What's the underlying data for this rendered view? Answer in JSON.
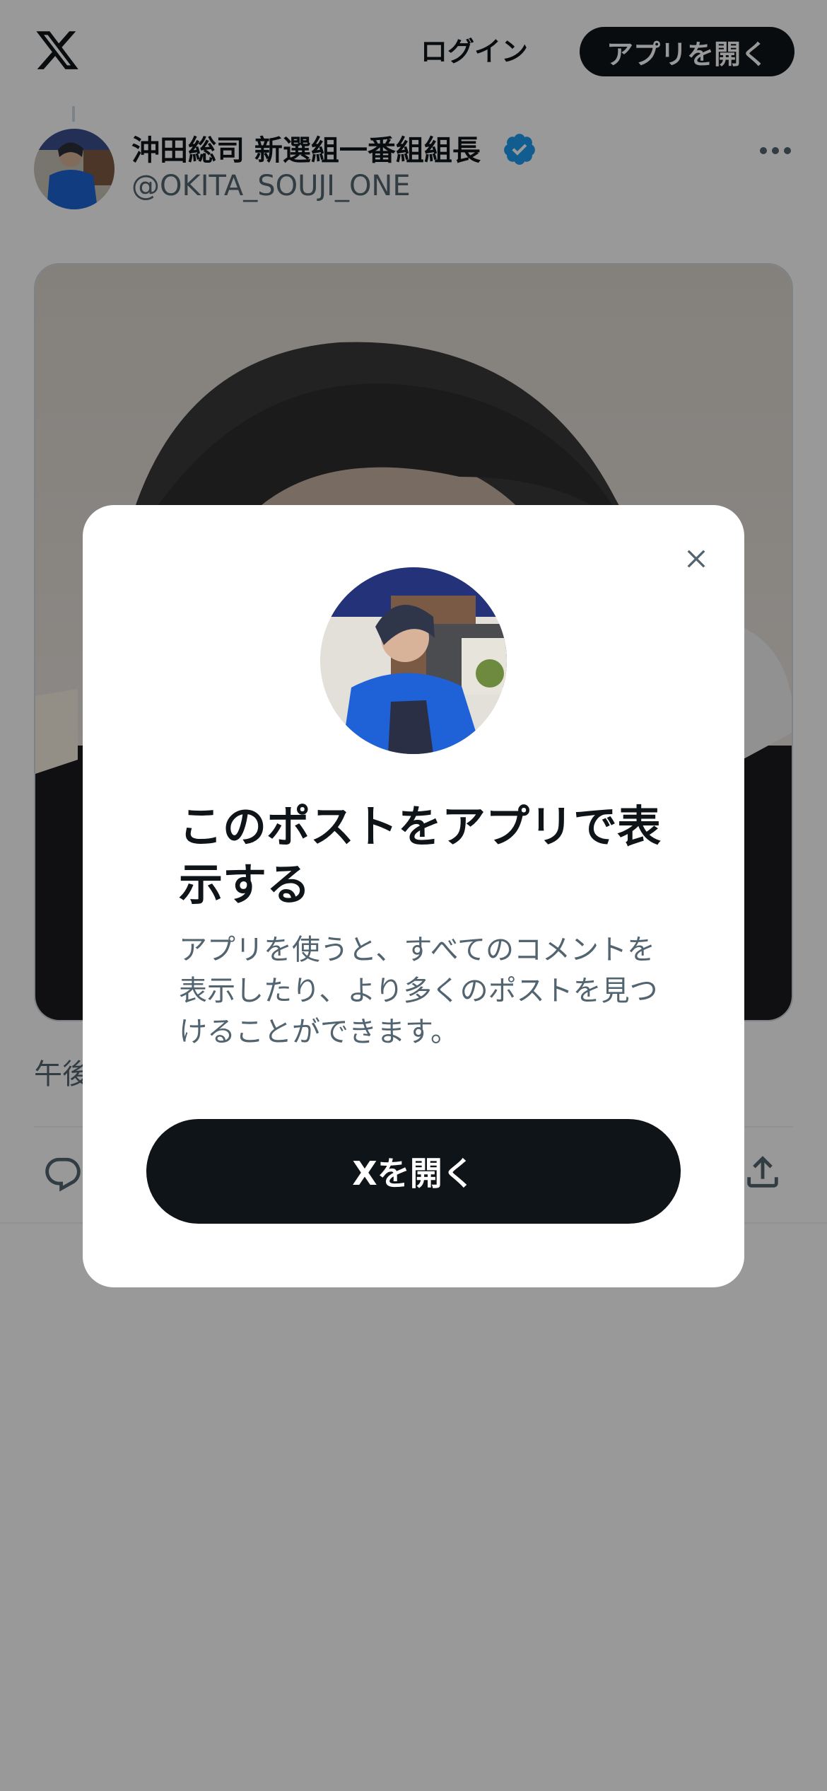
{
  "header": {
    "logo_icon": "x-logo-icon",
    "login_label": "ログイン",
    "open_app_label": "アプリを開く"
  },
  "post": {
    "display_name": "沖田総司 新選組一番組組長",
    "handle": "@OKITA_SOUJI_ONE",
    "verified": true,
    "timestamp_partial": "午後",
    "icons": [
      "more-icon",
      "reply-icon",
      "share-icon"
    ]
  },
  "modal": {
    "title": "このポストをアプリで表示する",
    "description": "アプリを使うと、すべてのコメントを表示したり、より多くのポストを見つけることができます。",
    "open_button_label": "Xを開く",
    "close_icon": "close-icon"
  },
  "colors": {
    "primary_text": "#0f1419",
    "secondary_text": "#536471",
    "verified_blue": "#1d9bf0",
    "button_dark": "#0f1419",
    "overlay": "rgba(0,0,0,0.40)"
  }
}
